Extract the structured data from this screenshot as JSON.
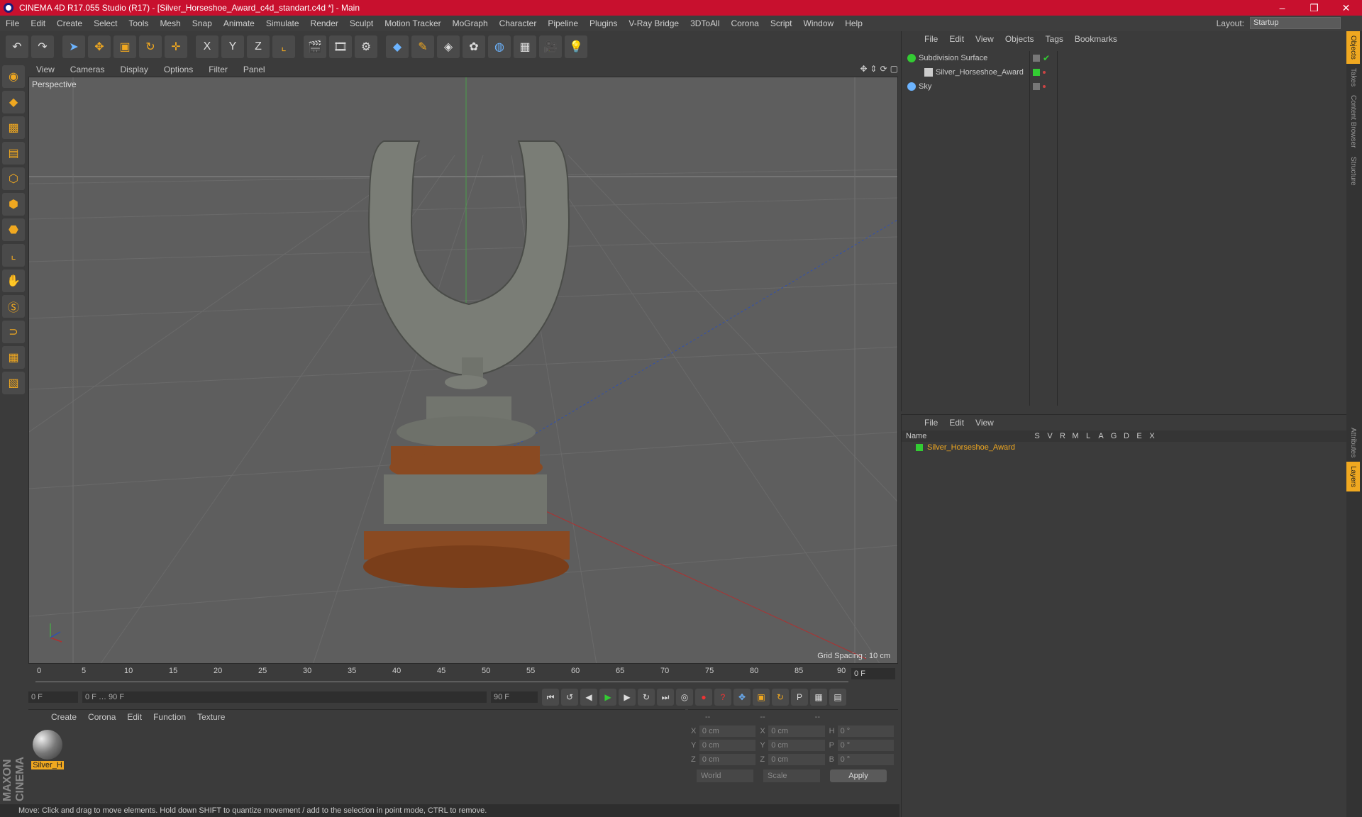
{
  "window": {
    "title": "CINEMA 4D R17.055 Studio (R17) - [Silver_Horseshoe_Award_c4d_standart.c4d *] - Main"
  },
  "menu": [
    "File",
    "Edit",
    "Create",
    "Select",
    "Tools",
    "Mesh",
    "Snap",
    "Animate",
    "Simulate",
    "Render",
    "Sculpt",
    "Motion Tracker",
    "MoGraph",
    "Character",
    "Pipeline",
    "Plugins",
    "V-Ray Bridge",
    "3DToAll",
    "Corona",
    "Script",
    "Window",
    "Help"
  ],
  "layout": {
    "label": "Layout:",
    "value": "Startup"
  },
  "viewport": {
    "menu": [
      "View",
      "Cameras",
      "Display",
      "Options",
      "Filter",
      "Panel"
    ],
    "label": "Perspective",
    "grid_spacing": "Grid Spacing : 10 cm"
  },
  "timeline": {
    "ticks": [
      "0",
      "5",
      "10",
      "15",
      "20",
      "25",
      "30",
      "35",
      "40",
      "45",
      "50",
      "55",
      "60",
      "65",
      "70",
      "75",
      "80",
      "85",
      "90"
    ],
    "current": "0 F"
  },
  "transport": {
    "start": "0 F",
    "range_start": "0 F",
    "range_end": "90 F",
    "end": "90 F"
  },
  "material_panel": {
    "menu": [
      "Create",
      "Corona",
      "Edit",
      "Function",
      "Texture"
    ],
    "material": "Silver_H"
  },
  "coords": {
    "headers": [
      "--",
      "--",
      "--"
    ],
    "rows": [
      {
        "a": "X",
        "av": "0 cm",
        "b": "X",
        "bv": "0 cm",
        "c": "H",
        "cv": "0 °"
      },
      {
        "a": "Y",
        "av": "0 cm",
        "b": "Y",
        "bv": "0 cm",
        "c": "P",
        "cv": "0 °"
      },
      {
        "a": "Z",
        "av": "0 cm",
        "b": "Z",
        "bv": "0 cm",
        "c": "B",
        "cv": "0 °"
      }
    ],
    "world": "World",
    "scale": "Scale",
    "apply": "Apply"
  },
  "status": "Move: Click and drag to move elements. Hold down SHIFT to quantize movement / add to the selection in point mode, CTRL to remove.",
  "objects_panel": {
    "menu": [
      "File",
      "Edit",
      "View",
      "Objects",
      "Tags",
      "Bookmarks"
    ],
    "items": [
      "Subdivision Surface",
      "Silver_Horseshoe_Award",
      "Sky"
    ]
  },
  "layers_panel": {
    "menu": [
      "File",
      "Edit",
      "View"
    ],
    "columns": [
      "Name",
      "S",
      "V",
      "R",
      "M",
      "L",
      "A",
      "G",
      "D",
      "E",
      "X"
    ],
    "row": "Silver_Horseshoe_Award"
  },
  "side_tabs": [
    "Objects",
    "Takes",
    "Content Browser",
    "Structure",
    "Attributes",
    "Layers"
  ],
  "brand": "MAXON CINEMA 4D"
}
